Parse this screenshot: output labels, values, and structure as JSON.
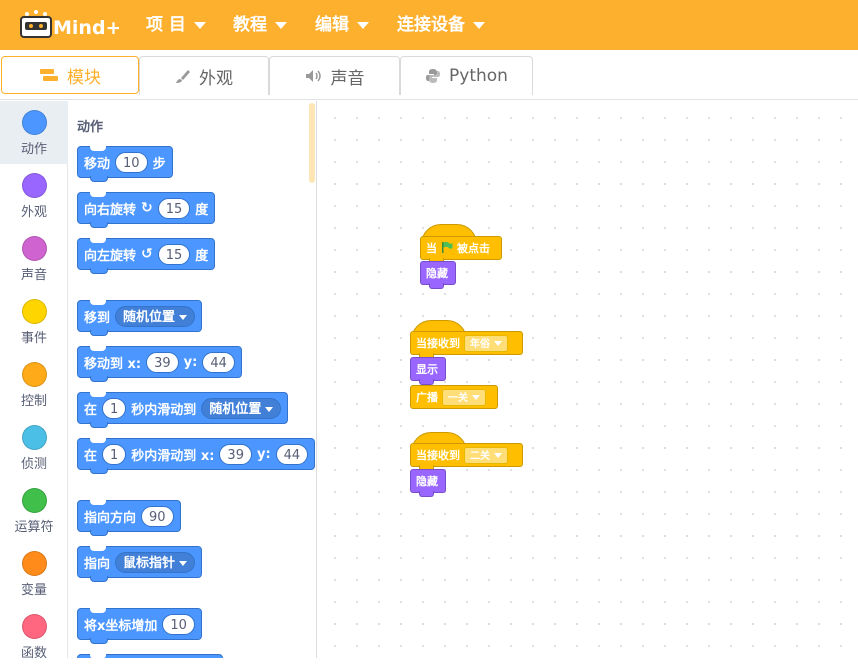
{
  "app": {
    "logo_text": "Mind+",
    "menu": [
      "项 目",
      "教程",
      "编辑",
      "连接设备"
    ]
  },
  "tabs": [
    {
      "label": "模块",
      "icon": "blocks-icon",
      "active": true
    },
    {
      "label": "外观",
      "icon": "brush-icon",
      "active": false
    },
    {
      "label": "声音",
      "icon": "speaker-icon",
      "active": false
    },
    {
      "label": "Python",
      "icon": "python-icon",
      "active": false
    }
  ],
  "categories": [
    {
      "label": "动作",
      "color": "#4c97ff",
      "selected": true
    },
    {
      "label": "外观",
      "color": "#9966ff"
    },
    {
      "label": "声音",
      "color": "#cf63cf"
    },
    {
      "label": "事件",
      "color": "#ffd500"
    },
    {
      "label": "控制",
      "color": "#ffab19"
    },
    {
      "label": "侦测",
      "color": "#4cbfe6"
    },
    {
      "label": "运算符",
      "color": "#40bf4a"
    },
    {
      "label": "变量",
      "color": "#ff8c1a"
    },
    {
      "label": "函数",
      "color": "#ff6680"
    }
  ],
  "palette": {
    "title": "动作",
    "blocks": {
      "move": {
        "text1": "移动",
        "value": "10",
        "text2": "步"
      },
      "turn_right": {
        "text1": "向右旋转",
        "value": "15",
        "text2": "度"
      },
      "turn_left": {
        "text1": "向左旋转",
        "value": "15",
        "text2": "度"
      },
      "goto": {
        "text1": "移到",
        "menu": "随机位置"
      },
      "goto_xy": {
        "text1": "移动到 x:",
        "x": "39",
        "text2": "y:",
        "y": "44"
      },
      "glide": {
        "text1": "在",
        "secs": "1",
        "text2": "秒内滑动到",
        "menu": "随机位置"
      },
      "glide_xy": {
        "text1": "在",
        "secs": "1",
        "text2": "秒内滑动到 x:",
        "x": "39",
        "text3": "y:",
        "y": "44"
      },
      "point_dir": {
        "text1": "指向方向",
        "value": "90"
      },
      "point_to": {
        "text1": "指向",
        "menu": "鼠标指针"
      },
      "change_x": {
        "text1": "将x坐标增加",
        "value": "10"
      }
    }
  },
  "workspace": {
    "script1": {
      "hat": "当",
      "hat_after": "被点击",
      "block": "隐藏"
    },
    "script2": {
      "hat": "当接收到",
      "hat_menu": "年俗",
      "block1": "显示",
      "block2": "广播",
      "block2_menu": "一关"
    },
    "script3": {
      "hat": "当接收到",
      "hat_menu": "二关",
      "block": "隐藏"
    }
  },
  "colors": {
    "accent": "#FDB02D",
    "motion": "#4c97ff",
    "looks": "#9966ff",
    "events": "#ffbf00"
  }
}
